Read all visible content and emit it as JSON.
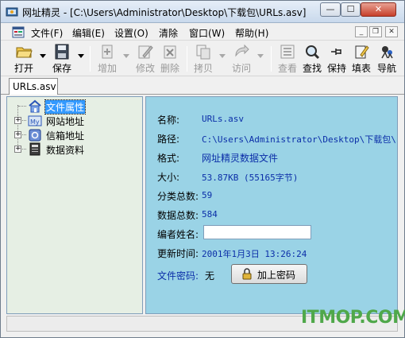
{
  "window": {
    "title": "网址精灵 - [C:\\Users\\Administrator\\Desktop\\下载包\\URLs.asv]",
    "min_symbol": "—",
    "max_symbol": "☐",
    "close_symbol": "✕"
  },
  "menu": {
    "items": [
      "文件(F)",
      "编辑(E)",
      "设置(O)",
      "清除",
      "窗口(W)",
      "帮助(H)"
    ],
    "mdi_min": "_",
    "mdi_restore": "❐",
    "mdi_close": "✕"
  },
  "toolbar": {
    "buttons": [
      {
        "label": "打开",
        "icon": "open-folder-icon",
        "enabled": true
      },
      {
        "label": "保存",
        "icon": "save-disk-icon",
        "enabled": true
      },
      {
        "label": "增加",
        "icon": "add-icon",
        "enabled": false
      },
      {
        "label": "修改",
        "icon": "edit-icon",
        "enabled": false
      },
      {
        "label": "删除",
        "icon": "delete-icon",
        "enabled": false
      },
      {
        "label": "拷贝",
        "icon": "copy-icon",
        "enabled": false
      },
      {
        "label": "访问",
        "icon": "visit-arrow-icon",
        "enabled": false
      },
      {
        "label": "查看",
        "icon": "view-icon",
        "enabled": false
      },
      {
        "label": "查找",
        "icon": "find-icon",
        "enabled": true
      },
      {
        "label": "保持",
        "icon": "pin-icon",
        "enabled": true
      },
      {
        "label": "填表",
        "icon": "fill-form-icon",
        "enabled": true
      },
      {
        "label": "导航",
        "icon": "navigate-icon",
        "enabled": true
      }
    ]
  },
  "tab": {
    "label": "URLs.asv"
  },
  "tree": {
    "nodes": [
      {
        "label": "文件属性",
        "icon": "house-icon",
        "selected": true
      },
      {
        "label": "网站地址",
        "icon": "my-site-icon",
        "expander": "+"
      },
      {
        "label": "信箱地址",
        "icon": "mailbox-icon",
        "expander": "+"
      },
      {
        "label": "数据资料",
        "icon": "book-icon",
        "expander": "+"
      }
    ]
  },
  "properties": {
    "name_label": "名称:",
    "name_value": "URLs.asv",
    "path_label": "路径:",
    "path_value": "C:\\Users\\Administrator\\Desktop\\下载包\\",
    "format_label": "格式:",
    "format_value": "网址精灵数据文件",
    "size_label": "大小:",
    "size_value": "53.87KB  (55165字节)",
    "categories_label": "分类总数:",
    "categories_value": "59",
    "records_label": "数据总数:",
    "records_value": "584",
    "author_label": "编者姓名:",
    "author_value": "",
    "updated_label": "更新时间:",
    "updated_value": "2001年1月3日  13:26:24",
    "password_label": "文件密码:",
    "password_value": "无",
    "add_password_button": "加上密码"
  },
  "watermark": "ITMOP.COM",
  "colors": {
    "content_bg": "#9ad3e6",
    "tree_bg": "#e6efe4",
    "value_text": "#0b2ea8",
    "selection": "#3399ff",
    "watermark": "#4fa84a"
  }
}
